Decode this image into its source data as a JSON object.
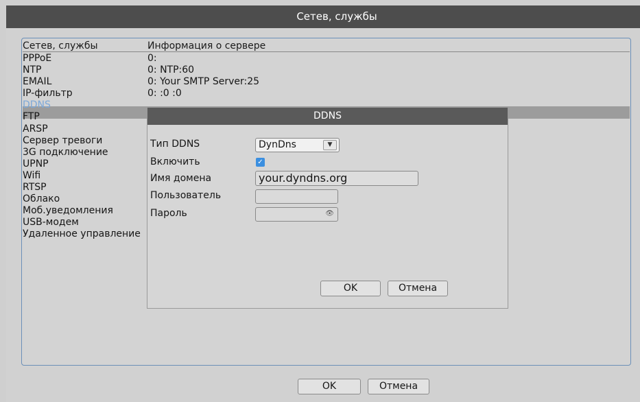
{
  "window": {
    "title": "Сетев, службы"
  },
  "columns": {
    "service": "Сетев, службы",
    "info": "Информация о сервере"
  },
  "services": [
    "PPPoE",
    "NTP",
    "EMAIL",
    "IP-фильтр",
    "DDNS",
    "FTP",
    "ARSP",
    "Сервер тревоги",
    "3G подключение",
    "UPNP",
    "Wifi",
    "RTSP",
    "Облако",
    "Моб.уведомления",
    "USB-модем",
    "Удаленное управление"
  ],
  "selected_service": "DDNS",
  "info": [
    "0:",
    "0: NTP:60",
    "0: Your SMTP Server:25",
    "0: :0 :0"
  ],
  "dialog": {
    "title": "DDNS",
    "type_label": "Тип DDNS",
    "type_value": "DynDns",
    "enable_label": "Включить",
    "enable_checked": true,
    "domain_label": "Имя домена",
    "domain_value": "your.dyndns.org",
    "user_label": "Пользователь",
    "user_value": "",
    "password_label": "Пароль",
    "password_value": "",
    "ok": "OK",
    "cancel": "Отмена"
  },
  "buttons": {
    "ok": "OK",
    "cancel": "Отмена"
  },
  "colors": {
    "titlebar": "#4d4d4d",
    "accent": "#3b8fe0",
    "selected_text": "#7ca8d8"
  }
}
